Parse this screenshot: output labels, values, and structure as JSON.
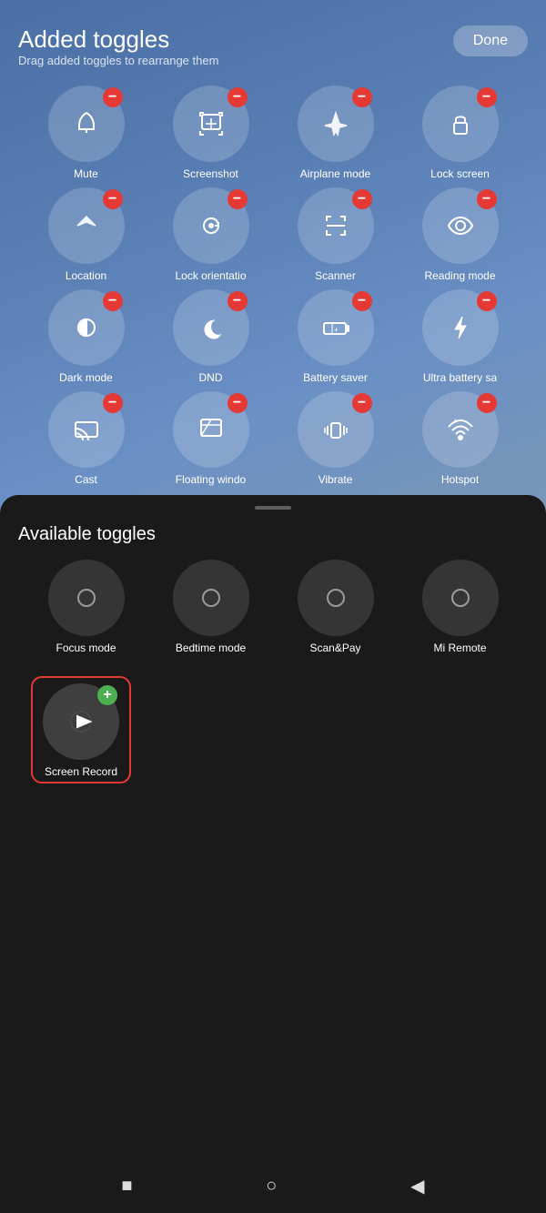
{
  "header": {
    "title": "Added toggles",
    "subtitle": "Drag added toggles to rearrange them",
    "done_label": "Done"
  },
  "added_toggles": [
    {
      "id": "mute",
      "label": "Mute",
      "icon": "bell"
    },
    {
      "id": "screenshot",
      "label": "Screenshot",
      "icon": "screenshot"
    },
    {
      "id": "airplane",
      "label": "Airplane mode",
      "icon": "airplane"
    },
    {
      "id": "lockscreen",
      "label": "Lock screen",
      "icon": "lock"
    },
    {
      "id": "location",
      "label": "Location",
      "icon": "location"
    },
    {
      "id": "lockorientation",
      "label": "Lock orientatio",
      "icon": "rotate"
    },
    {
      "id": "scanner",
      "label": "Scanner",
      "icon": "scanner"
    },
    {
      "id": "readingmode",
      "label": "Reading mode",
      "icon": "eye"
    },
    {
      "id": "darkmode",
      "label": "Dark mode",
      "icon": "darkmode"
    },
    {
      "id": "dnd",
      "label": "DND",
      "icon": "moon"
    },
    {
      "id": "batterysaver",
      "label": "Battery saver",
      "icon": "battery"
    },
    {
      "id": "ultrabattery",
      "label": "Ultra battery sa",
      "icon": "bolt"
    },
    {
      "id": "cast",
      "label": "Cast",
      "icon": "cast"
    },
    {
      "id": "floating",
      "label": "Floating windo",
      "icon": "floating"
    },
    {
      "id": "vibrate",
      "label": "Vibrate",
      "icon": "vibrate"
    },
    {
      "id": "hotspot",
      "label": "Hotspot",
      "icon": "wifi"
    }
  ],
  "available_section": {
    "title": "Available toggles"
  },
  "available_toggles": [
    {
      "id": "focusmode",
      "label": "Focus mode"
    },
    {
      "id": "bedtimemode",
      "label": "Bedtime mode"
    },
    {
      "id": "scanpay",
      "label": "Scan&Pay"
    },
    {
      "id": "miremote",
      "label": "Mi Remote"
    }
  ],
  "screen_record": {
    "label": "Screen Record"
  },
  "nav": {
    "square": "■",
    "circle": "○",
    "triangle": "◀"
  }
}
